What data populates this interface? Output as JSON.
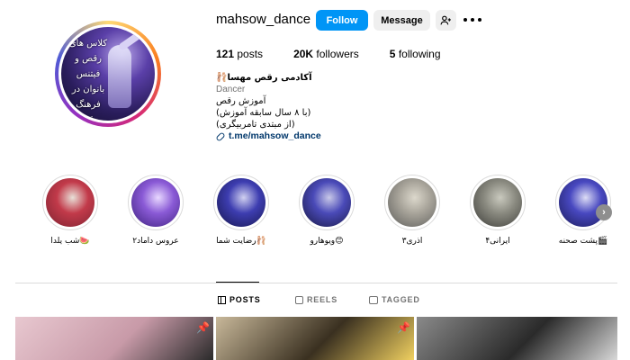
{
  "profile": {
    "username": "mahsow_dance",
    "avatar_text": "کلاس های رقص و فیتنس بانوان در فرهنگ رقص",
    "follow_label": "Follow",
    "message_label": "Message",
    "suggest_icon": "add-person-icon",
    "more_icon": "more-options-icon"
  },
  "stats": {
    "posts_count": "121",
    "posts_label": "posts",
    "followers_count": "20K",
    "followers_label": "followers",
    "following_count": "5",
    "following_label": "following"
  },
  "bio": {
    "name": "🩰آکادمی رقص مهسا",
    "category": "Dancer",
    "line1": "آموزش رقص",
    "line2": "(با ۸ سال سابقه آموزش)",
    "line3": "(از مبتدی تامربیگری)",
    "link": "t.me/mahsow_dance"
  },
  "highlights": [
    {
      "label": "شب یلدا🍉",
      "colors": [
        "#7a2230",
        "#c23a4a",
        "#e8e0d8"
      ]
    },
    {
      "label": "عروس داماد۲",
      "colors": [
        "#3b1f7a",
        "#8a5ad6",
        "#e8d8ff"
      ]
    },
    {
      "label": "رضایت شما🩰",
      "colors": [
        "#15154a",
        "#3d3db0",
        "#d0d0f0"
      ]
    },
    {
      "label": "ویوهارو😊",
      "colors": [
        "#16163e",
        "#4a4ab8",
        "#c8c8e8"
      ]
    },
    {
      "label": "اذری۳",
      "colors": [
        "#5a5a58",
        "#a8a49a",
        "#dcd8cc"
      ]
    },
    {
      "label": "ایرانی۴",
      "colors": [
        "#3a3a36",
        "#8a8a80",
        "#c9c9be"
      ]
    },
    {
      "label": "پشت صحنه🎬",
      "colors": [
        "#1a1a55",
        "#4848c0",
        "#dcdcf5"
      ]
    }
  ],
  "tabs": [
    {
      "label": "POSTS",
      "active": true
    },
    {
      "label": "REELS",
      "active": false
    },
    {
      "label": "TAGGED",
      "active": false
    }
  ],
  "posts": [
    {
      "kind": "photo",
      "pinned": true,
      "colors": [
        "#e8c8d0",
        "#c89aa8",
        "#2a2a2a"
      ]
    },
    {
      "kind": "photo",
      "pinned": true,
      "colors": [
        "#c8b89a",
        "#3a3020",
        "#f0d060"
      ]
    },
    {
      "kind": "photo",
      "pinned": false,
      "colors": [
        "#8a8a8a",
        "#2a2a2a",
        "#d8d8d8"
      ]
    }
  ]
}
